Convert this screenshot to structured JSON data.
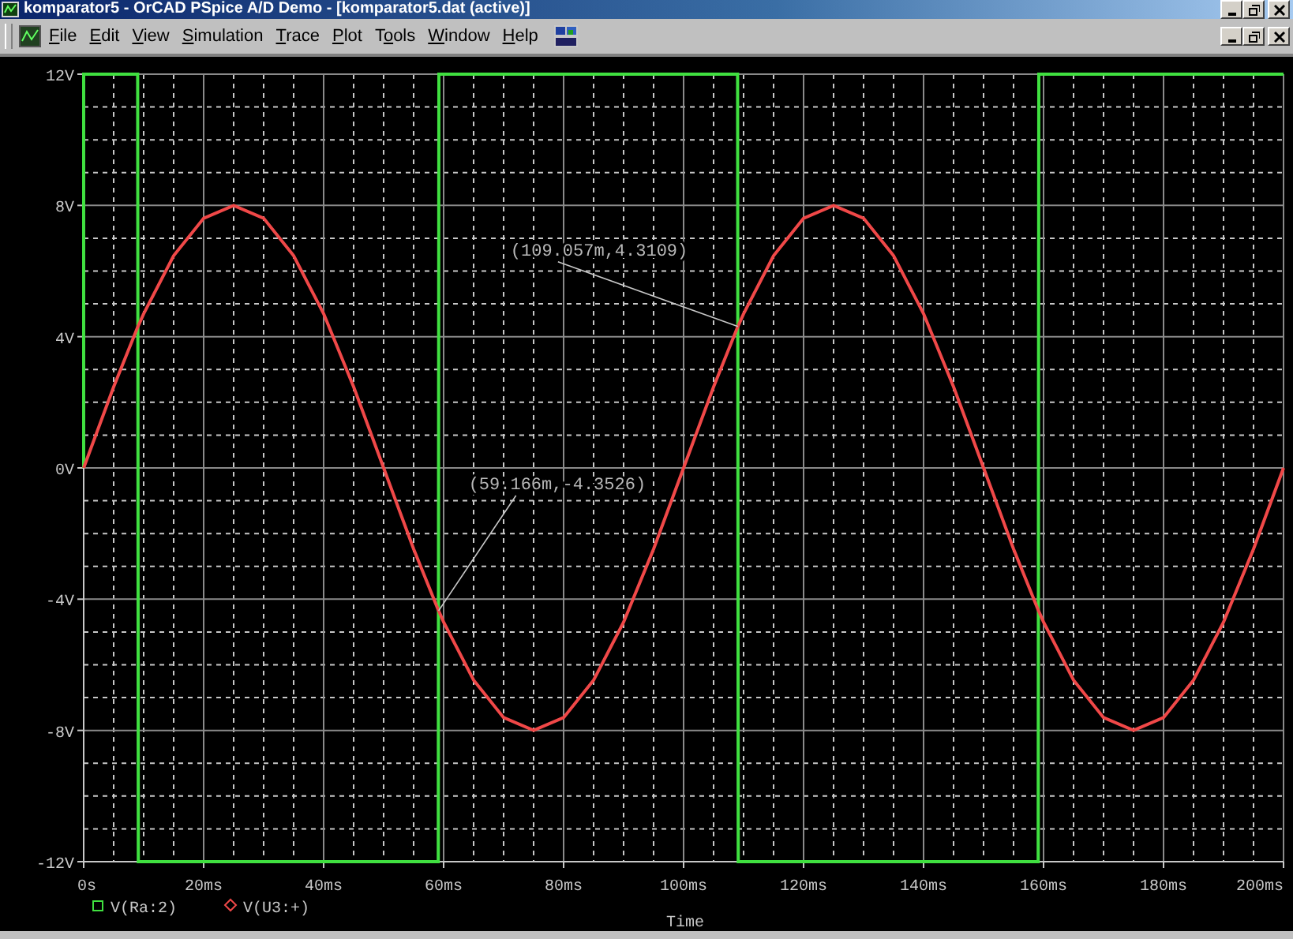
{
  "window": {
    "title": "komparator5 - OrCAD PSpice A/D Demo  - [komparator5.dat (active)]"
  },
  "menu": [
    {
      "key": "F",
      "post": "ile"
    },
    {
      "key": "E",
      "post": "dit"
    },
    {
      "key": "V",
      "post": "iew"
    },
    {
      "key": "S",
      "post": "imulation"
    },
    {
      "key": "T",
      "post": "race"
    },
    {
      "key": "P",
      "post": "lot"
    },
    {
      "pre": "T",
      "key": "o",
      "post": "ols"
    },
    {
      "key": "W",
      "post": "indow"
    },
    {
      "key": "H",
      "post": "elp"
    }
  ],
  "plot": {
    "chart_data": {
      "type": "line",
      "xlabel": "Time",
      "grid": true,
      "legend": true,
      "x": [
        0,
        0,
        5,
        9.0,
        9.1,
        10,
        15,
        20,
        25,
        30,
        35,
        40,
        45,
        50,
        55,
        59.1,
        59.2,
        60,
        65,
        70,
        75,
        80,
        85,
        90,
        95,
        100,
        105,
        109.0,
        109.1,
        110,
        115,
        120,
        125,
        130,
        135,
        140,
        145,
        150,
        155,
        159.1,
        159.2,
        160,
        165,
        170,
        175,
        180,
        185,
        190,
        195,
        200
      ],
      "series": [
        {
          "name": "V(Ra:2)",
          "color": "#40e040",
          "values": [
            0,
            12,
            12,
            12,
            -12,
            -12,
            -12,
            -12,
            -12,
            -12,
            -12,
            -12,
            -12,
            -12,
            -12,
            -12,
            12,
            12,
            12,
            12,
            12,
            12,
            12,
            12,
            12,
            12,
            12,
            12,
            -12,
            -12,
            -12,
            -12,
            -12,
            -12,
            -12,
            -12,
            -12,
            -12,
            -12,
            -12,
            12,
            12,
            12,
            12,
            12,
            12,
            12,
            12,
            12,
            12
          ]
        },
        {
          "name": "V(U3:+)",
          "color": "#f04848",
          "values": [
            0,
            0,
            2.47,
            4.29,
            4.33,
            4.7,
            6.47,
            7.61,
            8,
            7.61,
            6.47,
            4.7,
            2.47,
            0,
            -2.47,
            -4.33,
            -4.37,
            -4.7,
            -6.47,
            -7.61,
            -8,
            -7.61,
            -6.47,
            -4.7,
            -2.47,
            0,
            2.47,
            4.29,
            4.33,
            4.7,
            6.47,
            7.61,
            8,
            7.61,
            6.47,
            4.7,
            2.47,
            0,
            -2.47,
            -4.33,
            -4.37,
            -4.7,
            -6.47,
            -7.61,
            -8,
            -7.61,
            -6.47,
            -4.7,
            -2.47,
            0
          ]
        }
      ],
      "xlim": [
        0,
        200
      ],
      "ylim": [
        -12,
        12
      ],
      "xticks": [
        {
          "value": 0,
          "label": "0s"
        },
        {
          "value": 20,
          "label": "20ms"
        },
        {
          "value": 40,
          "label": "40ms"
        },
        {
          "value": 60,
          "label": "60ms"
        },
        {
          "value": 80,
          "label": "80ms"
        },
        {
          "value": 100,
          "label": "100ms"
        },
        {
          "value": 120,
          "label": "120ms"
        },
        {
          "value": 140,
          "label": "140ms"
        },
        {
          "value": 160,
          "label": "160ms"
        },
        {
          "value": 180,
          "label": "180ms"
        },
        {
          "value": 200,
          "label": "200ms"
        }
      ],
      "yticks": [
        {
          "value": 12,
          "label": "12V"
        },
        {
          "value": 8,
          "label": "8V"
        },
        {
          "value": 4,
          "label": "4V"
        },
        {
          "value": 0,
          "label": "0V"
        },
        {
          "value": -4,
          "label": "-4V"
        },
        {
          "value": -8,
          "label": "-8V"
        },
        {
          "value": -12,
          "label": "-12V"
        }
      ],
      "annotations": [
        {
          "text": "(109.057m,4.3109)",
          "x": 109.057,
          "y": 4.3109
        },
        {
          "text": "(59.166m,-4.3526)",
          "x": 59.166,
          "y": -4.3526
        }
      ]
    }
  }
}
